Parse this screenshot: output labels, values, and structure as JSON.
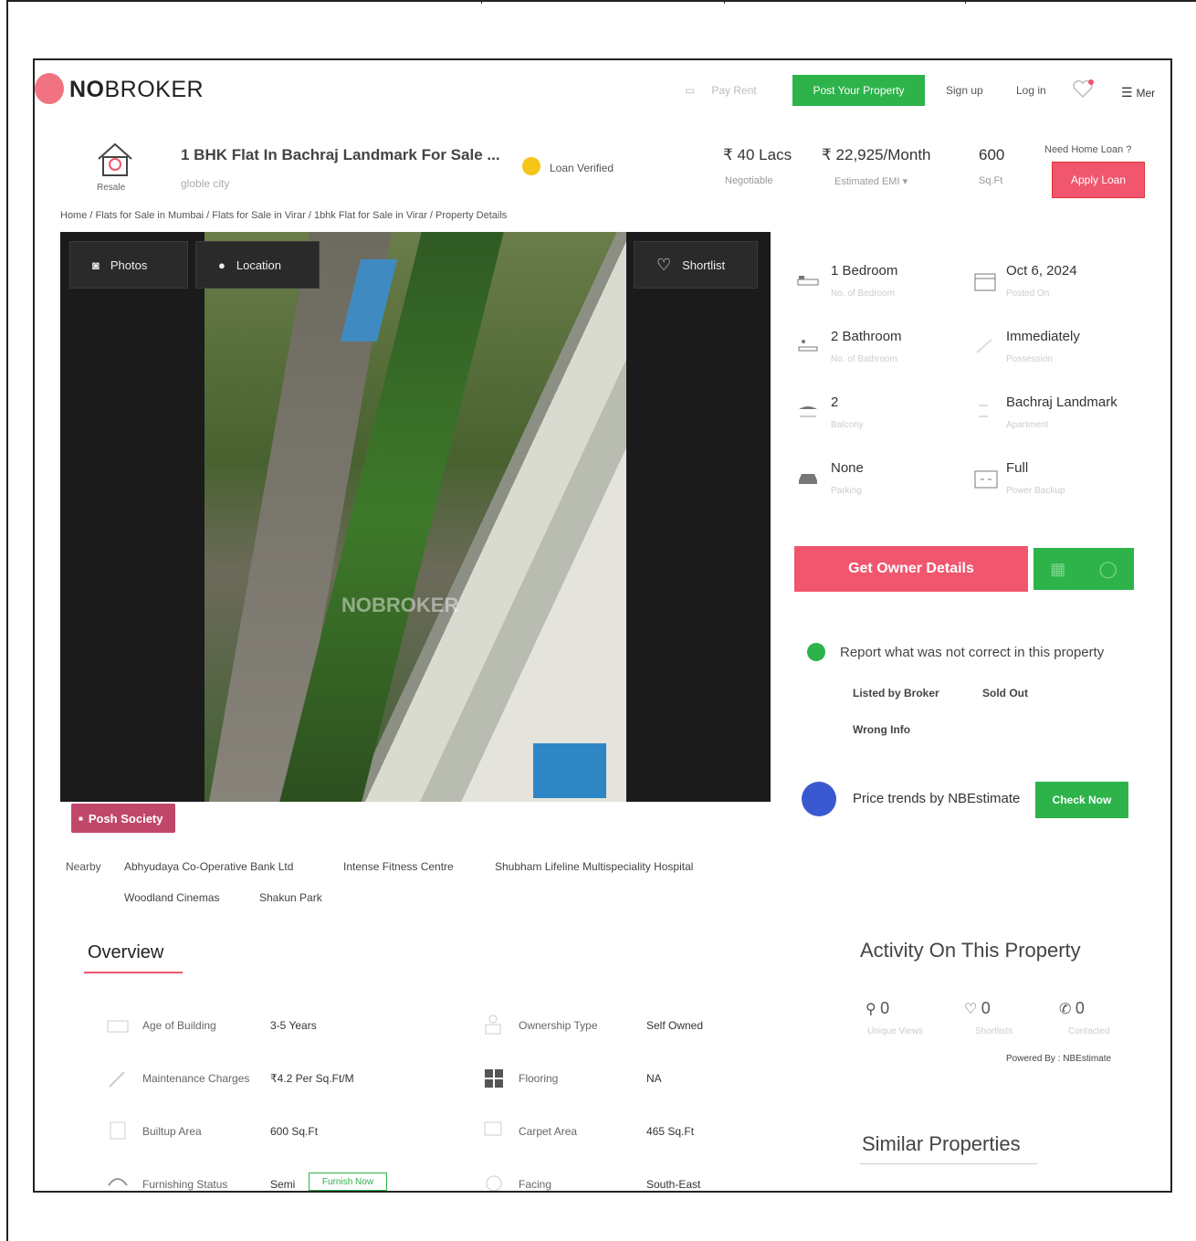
{
  "header": {
    "logo_text_bold": "NO",
    "logo_text_rest": "BROKER",
    "pay_rent": "Pay Rent",
    "post_property": "Post Your Property",
    "sign_up": "Sign up",
    "log_in": "Log in",
    "menu": "Mer"
  },
  "listing": {
    "badge": "Resale",
    "title": "1 BHK Flat In Bachraj Landmark For Sale ...",
    "subtitle": "globle city",
    "loan_verified": "Loan Verified",
    "price": "₹ 40 Lacs",
    "price_label": "Negotiable",
    "emi": "₹ 22,925/Month",
    "emi_label": "Estimated EMI ▾",
    "area": "600",
    "area_label": "Sq.Ft",
    "need_loan": "Need Home Loan ?",
    "apply_loan": "Apply Loan"
  },
  "breadcrumb": "Home / Flats for Sale in Mumbai / Flats for Sale in Virar / 1bhk Flat for Sale in Virar / Property Details",
  "gallery": {
    "photos": "Photos",
    "location": "Location",
    "shortlist": "Shortlist",
    "watermark": "NOBROKER"
  },
  "posh_society": "Posh Society",
  "nearby": {
    "label": "Nearby",
    "items": [
      "Abhyudaya Co-Operative Bank Ltd",
      "Intense Fitness Centre",
      "Shubham Lifeline Multispeciality Hospital",
      "Woodland Cinemas",
      "Shakun Park"
    ]
  },
  "details": [
    {
      "value": "1 Bedroom",
      "label": "No. of Bedroom",
      "icon": "bed-icon"
    },
    {
      "value": "Oct 6, 2024",
      "label": "Posted On",
      "icon": "calendar-icon"
    },
    {
      "value": "2 Bathroom",
      "label": "No. of Bathroom",
      "icon": "bathtub-icon"
    },
    {
      "value": "Immediately",
      "label": "Possession",
      "icon": "key-icon"
    },
    {
      "value": "2",
      "label": "Balcony",
      "icon": "balcony-icon"
    },
    {
      "value": "Bachraj Landmark",
      "label": "Apartment",
      "icon": "apartment-icon"
    },
    {
      "value": "None",
      "label": "Parking",
      "icon": "car-icon"
    },
    {
      "value": "Full",
      "label": "Power Backup",
      "icon": "power-icon"
    }
  ],
  "actions": {
    "owner_details": "Get Owner Details"
  },
  "report": {
    "text": "Report what was not correct in this property",
    "tags": [
      "Listed by Broker",
      "Sold Out",
      "Wrong Info"
    ]
  },
  "trends": {
    "text": "Price trends by NBEstimate",
    "button": "Check Now"
  },
  "overview": {
    "title": "Overview",
    "rows": [
      {
        "label": "Age of Building",
        "value": "3-5 Years",
        "icon": "building-age-icon"
      },
      {
        "label": "Ownership Type",
        "value": "Self Owned",
        "icon": "ownership-icon"
      },
      {
        "label": "Maintenance Charges",
        "value": "₹4.2 Per Sq.Ft/M",
        "icon": "maintenance-icon"
      },
      {
        "label": "Flooring",
        "value": "NA",
        "icon": "flooring-icon"
      },
      {
        "label": "Builtup Area",
        "value": "600 Sq.Ft",
        "icon": "builtup-area-icon"
      },
      {
        "label": "Carpet Area",
        "value": "465 Sq.Ft",
        "icon": "carpet-area-icon"
      },
      {
        "label": "Furnishing Status",
        "value": "Semi",
        "icon": "furnishing-icon"
      },
      {
        "label": "Facing",
        "value": "South-East",
        "icon": "compass-icon"
      }
    ],
    "furnish_now": "Furnish Now"
  },
  "activity": {
    "title": "Activity On This Property",
    "views": "0",
    "views_label": "Unique Views",
    "shortlists": "0",
    "shortlists_label": "Shortlists",
    "contacted": "0",
    "contacted_label": "Contacted",
    "powered": "Powered By : NBEstimate"
  },
  "similar": {
    "title": "Similar Properties"
  },
  "colors": {
    "brand_red": "#f0566e",
    "brand_green": "#2db34a",
    "posh_pink": "#c1476a",
    "estimate_blue": "#3a59d1"
  }
}
